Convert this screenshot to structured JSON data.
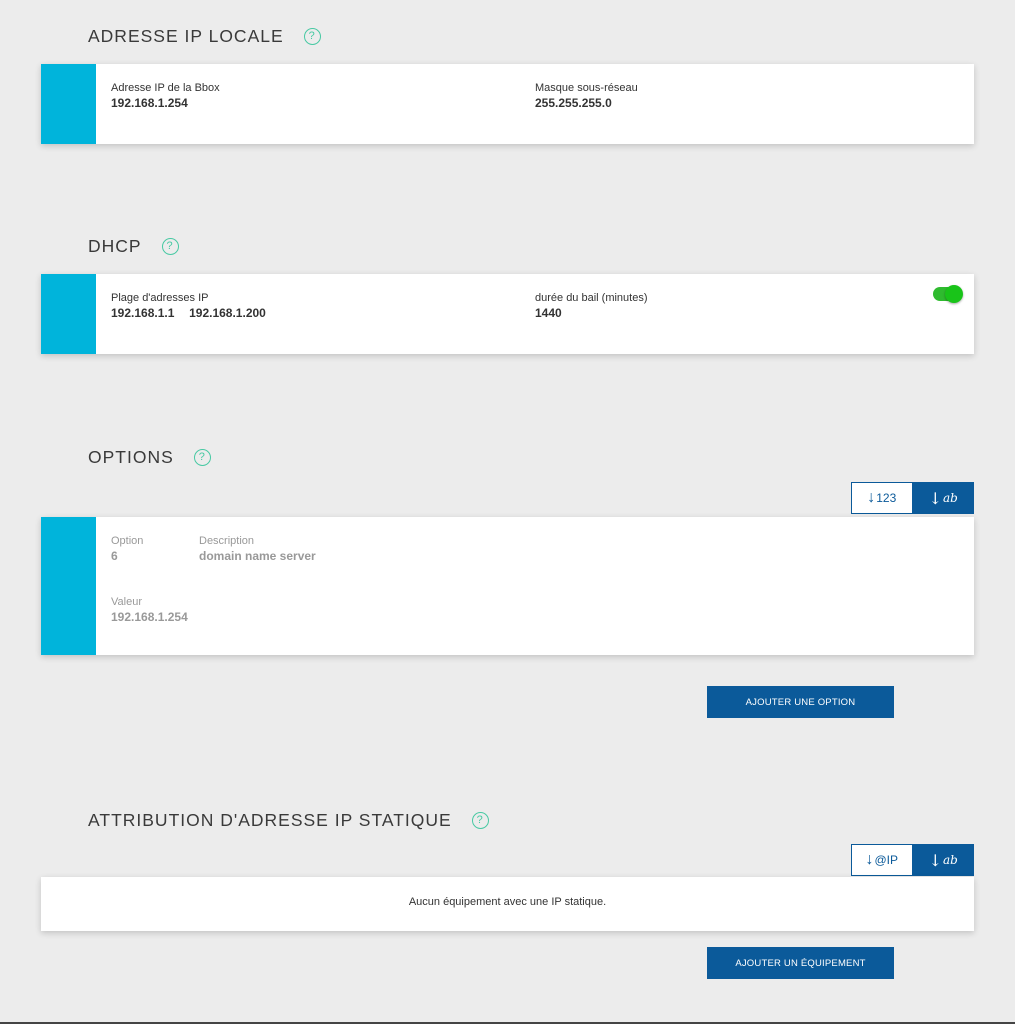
{
  "sections": {
    "local_ip": {
      "title": "ADRESSE IP LOCALE",
      "help": "?",
      "bbox_ip_label": "Adresse IP de la Bbox",
      "bbox_ip_value": "192.168.1.254",
      "mask_label": "Masque sous-réseau",
      "mask_value": "255.255.255.0"
    },
    "dhcp": {
      "title": "DHCP",
      "help": "?",
      "range_label": "Plage d'adresses IP",
      "range_start": "192.168.1.1",
      "range_end": "192.168.1.200",
      "lease_label": "durée du bail (minutes)",
      "lease_value": "1440",
      "enabled": true
    },
    "options": {
      "title": "OPTIONS",
      "help": "?",
      "sort_numeric_label": "123",
      "sort_alpha_label": "ab",
      "option_label": "Option",
      "option_value": "6",
      "description_label": "Description",
      "description_value": "domain name server",
      "value_label": "Valeur",
      "value_value": "192.168.1.254",
      "add_button": "AJOUTER UNE OPTION"
    },
    "static_ip": {
      "title": "ATTRIBUTION D'ADRESSE IP STATIQUE",
      "help": "?",
      "sort_ip_label": "@IP",
      "sort_alpha_label": "ab",
      "empty_message": "Aucun équipement avec une IP statique.",
      "add_button": "AJOUTER UN ÉQUIPEMENT"
    }
  },
  "colors": {
    "accent": "#00b4db",
    "primary": "#0b5a9a",
    "help": "#48c9a3",
    "toggle_on": "#19c419",
    "background": "#ececec"
  }
}
